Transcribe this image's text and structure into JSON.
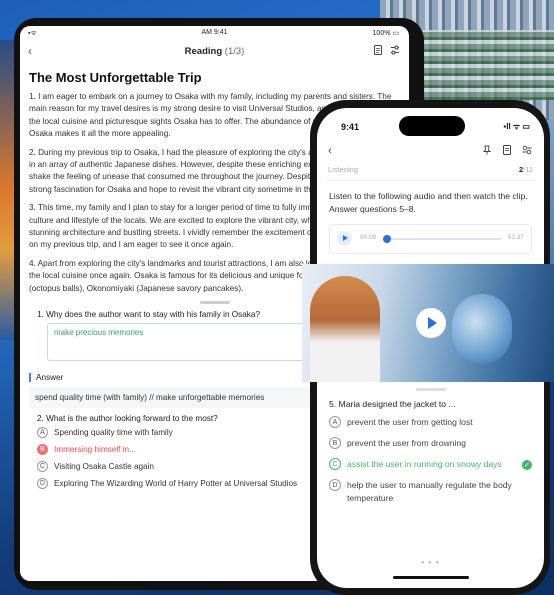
{
  "tablet": {
    "status": {
      "signal": "▪︎ᯤ",
      "time": "AM 9:41",
      "battery": "100% ▭"
    },
    "nav": {
      "back": "‹",
      "title": "Reading",
      "count": "(1/3)"
    },
    "article_title": "The Most Unforgettable Trip",
    "paragraphs": [
      "1. I am eager to embark on a journey to Osaka with my family, including my parents and sisters. The main reason for my travel desires is my strong desire to visit Universal Studios, as well as indulge in the local cuisine and picturesque sights Osaka has to offer. The abundance of my favorite foods in Osaka makes it all the more appealing.",
      "2. During my previous trip to Osaka, I had the pleasure of exploring the city's attractions and relishing in an array of authentic Japanese dishes. However, despite these enriching experiences, I could not shake the feeling of unease that consumed me throughout the journey. Despite this, I still hold a strong fascination for Osaka and hope to revisit the vibrant city sometime in the future.",
      "3. This time, my family and I plan to stay for a longer period of time to fully immerse ourselves in the culture and lifestyle of the locals. We are excited to explore the vibrant city, which is known for its stunning architecture and bustling streets. I vividly remember the excitement of visiting Osaka Castle on my previous trip, and I am eager to see it once again.",
      "4. Apart from exploring the city's landmarks and tourist attractions, I am also looking forward to trying the local cuisine once again. Osaka is famous for its delicious and unique food, such as Takoyaki (octopus balls), Okonomiyaki (Japanese savory pancakes)."
    ],
    "question1": "1. Why does the author want to stay with his family in Osaka?",
    "question1_input": "make precious memories",
    "answer_heading": "Answer",
    "answer_text": "spend quality time (with family) // make unforgettable memories",
    "question2": "2. What is the author looking forward to the most?",
    "options": [
      {
        "letter": "A",
        "text": "Spending quality time with family"
      },
      {
        "letter": "B",
        "text": "Immersing himself in..."
      },
      {
        "letter": "C",
        "text": "Visiting Osaka Castle again"
      },
      {
        "letter": "D",
        "text": "Exploring The Wizarding World of Harry Potter at Universal Studios"
      }
    ]
  },
  "phone": {
    "status": {
      "time": "9:41",
      "icons": "▪︎ll ᯤ ▭"
    },
    "nav": {
      "back": "‹"
    },
    "section": "Listening",
    "page_current": "2",
    "page_total": "/11",
    "instructions": "Listen to the following audio and then watch the clip. Answer questions 5–8.",
    "audio": {
      "elapsed": "00:00",
      "duration": "01:37",
      "progress": 0.0
    },
    "question5": "5. Maria designed the jacket to ...",
    "options": [
      {
        "letter": "A",
        "text": "prevent the user from getting lost"
      },
      {
        "letter": "B",
        "text": "prevent the user from drowning"
      },
      {
        "letter": "C",
        "text": "assist the user in running on snowy days"
      },
      {
        "letter": "D",
        "text": "help the user to manually regulate the body temperature"
      }
    ],
    "correct_mark": "✓",
    "dots": "● ● ●"
  },
  "colors": {
    "accent": "#2b6de0",
    "correct": "#48b565",
    "wrong": "#e64b4b"
  }
}
